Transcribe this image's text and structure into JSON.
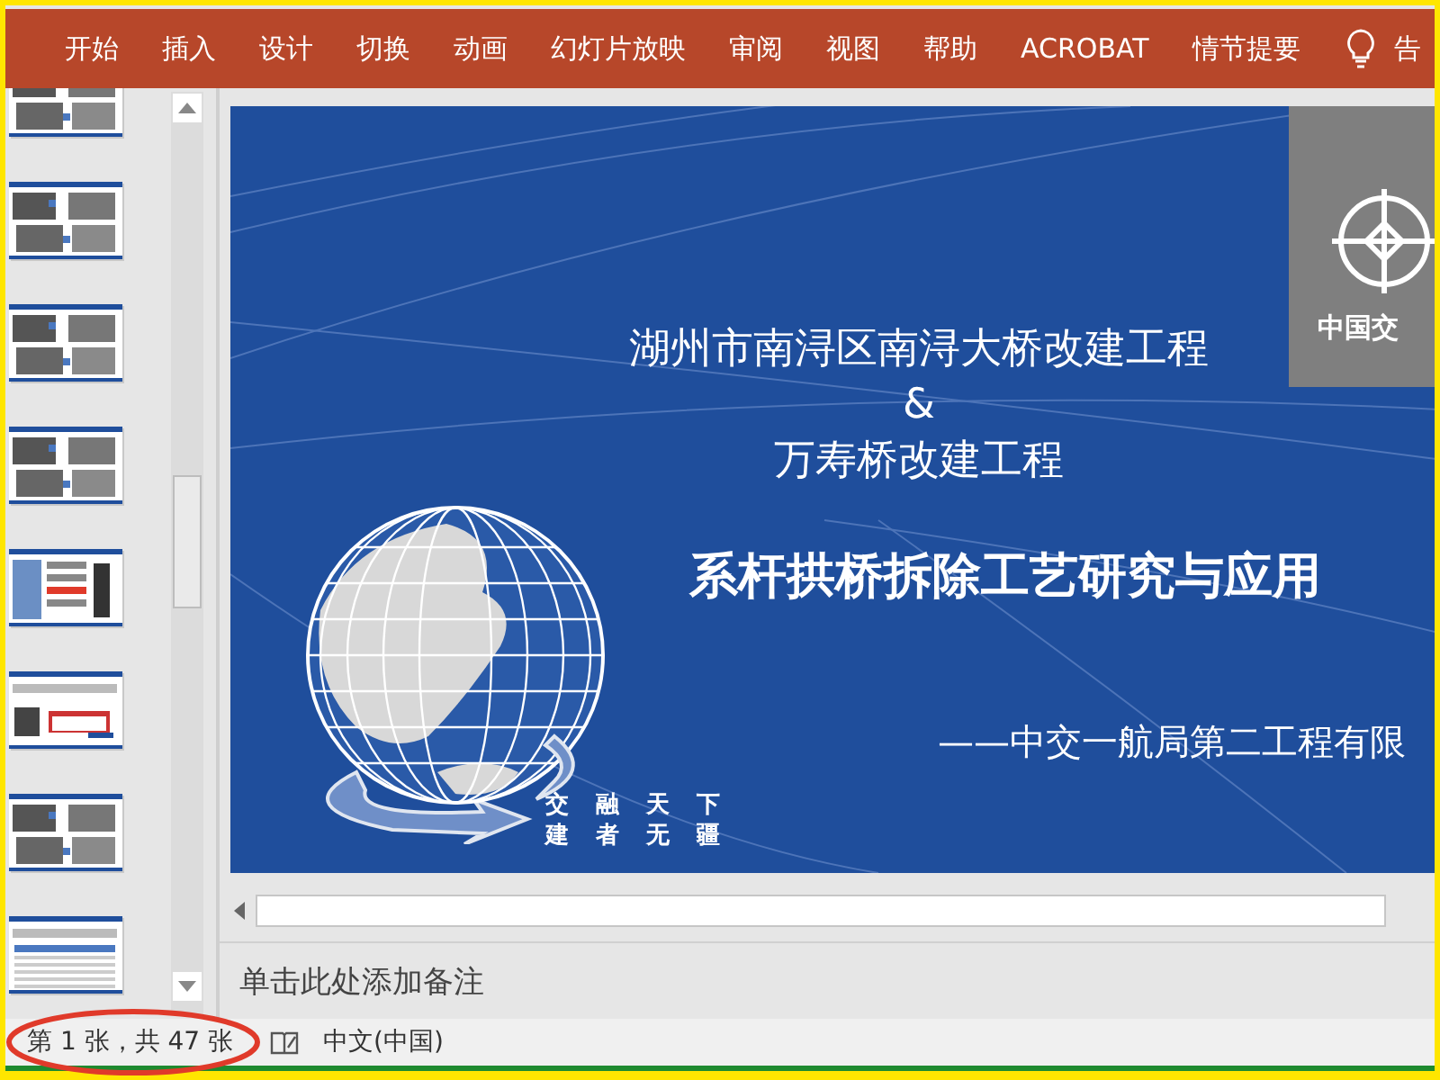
{
  "ribbon": {
    "tabs": [
      {
        "label": "开始",
        "selected": false
      },
      {
        "label": "插入",
        "selected": false
      },
      {
        "label": "设计",
        "selected": false
      },
      {
        "label": "切换",
        "selected": false
      },
      {
        "label": "动画",
        "selected": false
      },
      {
        "label": "幻灯片放映",
        "selected": false
      },
      {
        "label": "审阅",
        "selected": false
      },
      {
        "label": "视图",
        "selected": false
      },
      {
        "label": "帮助",
        "selected": false
      },
      {
        "label": "ACROBAT",
        "selected": false
      },
      {
        "label": "情节提要",
        "selected": false
      }
    ],
    "tell_me": "告"
  },
  "thumbnails": [
    {
      "kind": "photos"
    },
    {
      "kind": "photos"
    },
    {
      "kind": "photos"
    },
    {
      "kind": "photos"
    },
    {
      "kind": "list"
    },
    {
      "kind": "diagram"
    },
    {
      "kind": "photos"
    },
    {
      "kind": "table"
    }
  ],
  "slide": {
    "title_lines": [
      "湖州市南浔区南浔大桥改建工程",
      "&",
      "万寿桥改建工程"
    ],
    "heading": "系杆拱桥拆除工艺研究与应用",
    "byline": "——中交一航局第二工程有限",
    "logo_text": "中国交",
    "slogan": [
      "交融天下",
      "建者无疆"
    ]
  },
  "notes": {
    "placeholder": "单击此处添加备注"
  },
  "status_bar": {
    "slide_count": "第 1 张，共 47 张",
    "language": "中文(中国)"
  }
}
